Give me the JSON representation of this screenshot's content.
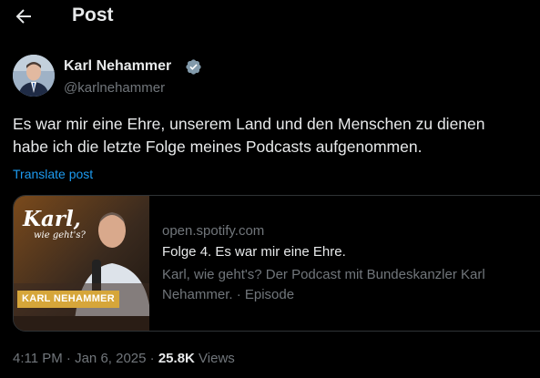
{
  "header": {
    "title": "Post",
    "back_icon": "arrow-left-icon"
  },
  "author": {
    "name": "Karl Nehammer",
    "handle": "@karlnehammer",
    "verified_icon": "verified-badge-icon",
    "verified_color": "#829aab"
  },
  "post": {
    "text": "Es war mir eine Ehre, unserem Land und den Menschen zu dienen\nhabe ich die letzte Folge meines Podcasts aufgenommen.",
    "translate_label": "Translate post"
  },
  "link_card": {
    "domain": "open.spotify.com",
    "title": "Folge 4. Es war mir eine Ehre.",
    "description": "Karl, wie geht's? Der Podcast mit Bundeskanzler Karl Nehammer. · Episode",
    "thumbnail": {
      "title": "Karl,",
      "subtitle": "wie geht's?",
      "banner": "KARL NEHAMMER"
    }
  },
  "meta": {
    "time": "4:11 PM",
    "date": "Jan 6, 2025",
    "separator": "·",
    "views_count": "25.8K",
    "views_label": "Views"
  },
  "colors": {
    "background": "#000000",
    "link": "#1d9bf0",
    "muted": "#71767b",
    "text": "#e7e9ea"
  }
}
